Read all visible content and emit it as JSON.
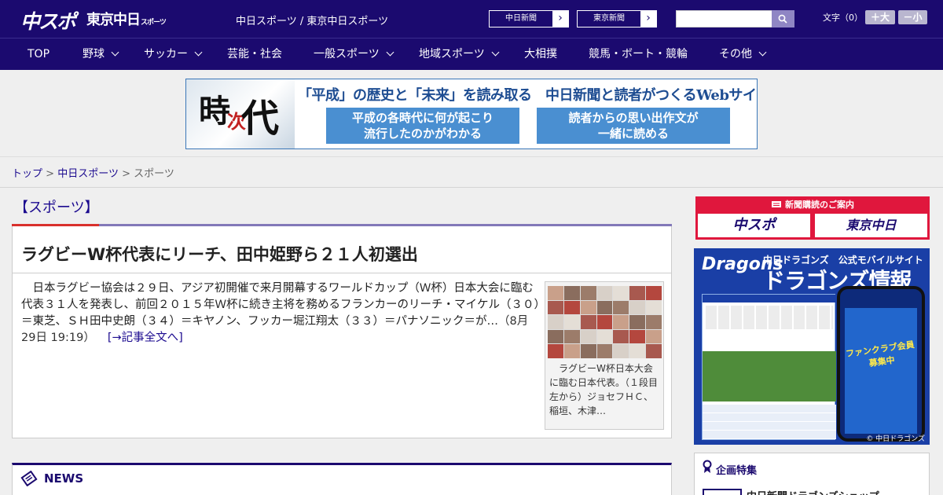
{
  "header": {
    "logo_main": "中スポ",
    "logo_tokyo": "東京中日",
    "logo_tokyo_small": "スポーツ",
    "site_title": "中日スポーツ / 東京中日スポーツ",
    "paper_buttons": [
      {
        "label": "中日新聞",
        "arrow": "›"
      },
      {
        "label": "東京新聞",
        "arrow": "›"
      }
    ],
    "search": {
      "placeholder": "",
      "value": ""
    },
    "fontsize_label": "文字（0）",
    "fontsize_up": "＋大",
    "fontsize_down": "－小"
  },
  "nav": {
    "items": [
      {
        "label": "TOP",
        "has_dropdown": false
      },
      {
        "label": "野球",
        "has_dropdown": true
      },
      {
        "label": "サッカー",
        "has_dropdown": true
      },
      {
        "label": "芸能・社会",
        "has_dropdown": false
      },
      {
        "label": "一般スポーツ",
        "has_dropdown": true
      },
      {
        "label": "地域スポーツ",
        "has_dropdown": true
      },
      {
        "label": "大相撲",
        "has_dropdown": false
      },
      {
        "label": "競馬・ボート・競輪",
        "has_dropdown": false
      },
      {
        "label": "その他",
        "has_dropdown": true
      }
    ]
  },
  "banner": {
    "kanji_1": "時",
    "kanji_2": "次",
    "kanji_3": "代",
    "headline": "「平成」の歴史と「未来」を読み取る　中日新聞と読者がつくるWebサイト",
    "box_left": [
      "平成の各時代に何が起こり",
      "流行したのかがわかる"
    ],
    "box_right": [
      "読者からの思い出作文が",
      "一緒に読める"
    ]
  },
  "breadcrumb": {
    "home": "トップ",
    "sep": ">",
    "category": "中日スポーツ",
    "current": "スポーツ"
  },
  "section": {
    "title": "【スポーツ】"
  },
  "article": {
    "headline": "ラグビーW杯代表にリーチ、田中姫野ら２１人初選出",
    "body": "　日本ラグビー協会は２９日、アジア初開催で来月開幕するワールドカップ（Ｗ杯）日本大会に臨む代表３１人を発表し、前回２０１５年Ｗ杯に続き主将を務めるフランカーのリーチ・マイケル（３０）＝東芝、ＳＨ田中史朗（３４）＝キヤノン、フッカー堀江翔太（３３）＝パナソニック＝が…",
    "date": "（8月29日 19:19）",
    "more_link": "[→記事全文へ]",
    "image_caption": "　ラグビーW杯日本大会に臨む日本代表。（１段目左から）ジョセフＨＣ、稲垣、木津…"
  },
  "news": {
    "label": "NEWS"
  },
  "sidebar": {
    "subscription": {
      "title": "新聞購読のご案内",
      "logo_left": "中スポ",
      "logo_right": "東京中日"
    },
    "dragons_ad": {
      "logo": "Dragons",
      "sub": "中日ドラゴンズ　公式モバイルサイト",
      "big": "ドラゴンズ情報",
      "phone_text": "ファンクラブ会員募集中",
      "copyright": "© 中日ドラゴンズ"
    },
    "kikaku": {
      "title": "企画特集",
      "item": "中日新聞ドラゴンズショップ"
    }
  },
  "colors": {
    "brand_navy": "#1b0a6f",
    "accent_red": "#d9302c",
    "link": "#1b0a8f"
  }
}
